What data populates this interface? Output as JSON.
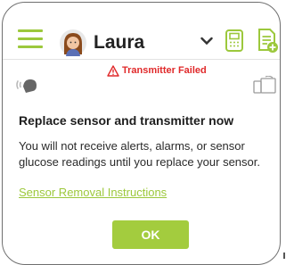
{
  "header": {
    "menu_icon": "hamburger-menu-icon",
    "user_name": "Laura",
    "dropdown_icon": "chevron-down-icon",
    "device_icon": "transmitter-device-icon",
    "log_icon": "add-log-icon"
  },
  "status": {
    "signal_icon": "sensor-signal-icon",
    "warning_icon": "warning-triangle-icon",
    "text": "Transmitter Failed",
    "phone_icon": "phone-connection-icon"
  },
  "alert": {
    "title": "Replace sensor and transmitter now",
    "message": "You will not receive alerts, alarms, or sensor glucose readings until you replace your sensor.",
    "link_text": "Sensor Removal Instructions",
    "ok_label": "OK"
  },
  "colors": {
    "accent": "#9cc83c",
    "error": "#e0292a",
    "text": "#222222"
  }
}
